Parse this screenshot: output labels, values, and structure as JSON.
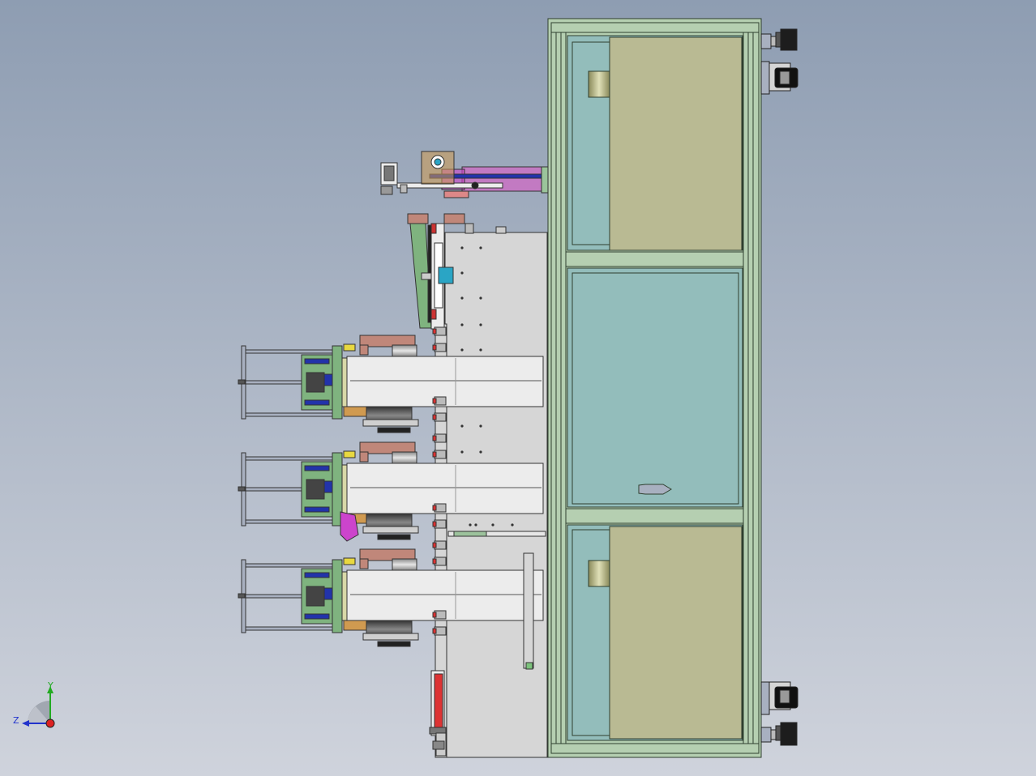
{
  "viewport": {
    "background_top": "#8e9db2",
    "background_bottom": "#cfd3dc"
  },
  "colors": {
    "frame_green": "#b5cfb1",
    "frame_stroke": "#2f3f2f",
    "panel_teal": "#93bdbb",
    "panel_khaki": "#b9ba93",
    "light_gray": "#d6d6d6",
    "white_gray": "#ececec",
    "rod_gray": "#a8b0c0",
    "brown": "#c0877a",
    "blue": "#2233aa",
    "magenta": "#cc44cc",
    "pink": "#c27ac2",
    "red": "#dd3333",
    "dark": "#222222",
    "yellow": "#e8d840",
    "orange": "#d09a50",
    "olive_green": "#7fb37f",
    "axis_x": "#2233cc",
    "axis_y": "#22aa22",
    "axis_z_dot": "#dd2222"
  },
  "icons": {
    "orientation_triad": "xyz-axes-icon",
    "leveling_foot": "leveling-foot-icon",
    "caster_wheel": "caster-wheel-icon",
    "handle": "handle-icon"
  },
  "triad": {
    "y_label": "Y",
    "z_label": "Z"
  }
}
